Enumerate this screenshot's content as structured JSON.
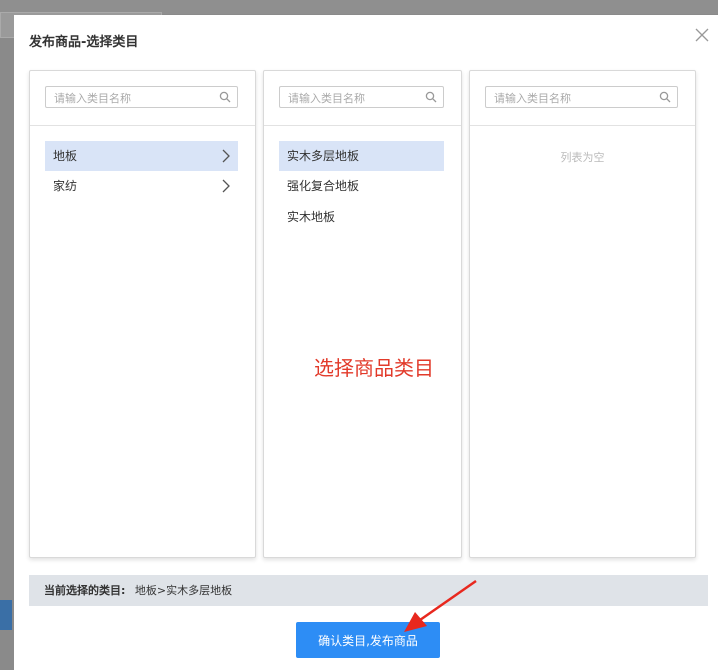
{
  "modal": {
    "title": "发布商品-选择类目"
  },
  "columns": [
    {
      "placeholder": "请输入类目名称",
      "items": [
        {
          "label": "地板",
          "selected": true
        },
        {
          "label": "家纺",
          "selected": false
        }
      ]
    },
    {
      "placeholder": "请输入类目名称",
      "items": [
        {
          "label": "实木多层地板",
          "selected": true
        },
        {
          "label": "强化复合地板",
          "selected": false
        },
        {
          "label": "实木地板",
          "selected": false
        }
      ]
    },
    {
      "placeholder": "请输入类目名称",
      "empty_text": "列表为空"
    }
  ],
  "annotation": "选择商品类目",
  "current_selection": {
    "label": "当前选择的类目:",
    "value": "地板>实木多层地板"
  },
  "confirm_button": "确认类目,发布商品",
  "colors": {
    "accent": "#2d8df5",
    "selected_bg": "#d9e4f7",
    "annotation": "#e23a2a"
  },
  "icons": {
    "search": "search-icon",
    "close": "close-icon",
    "chevron": "chevron-right-icon"
  }
}
